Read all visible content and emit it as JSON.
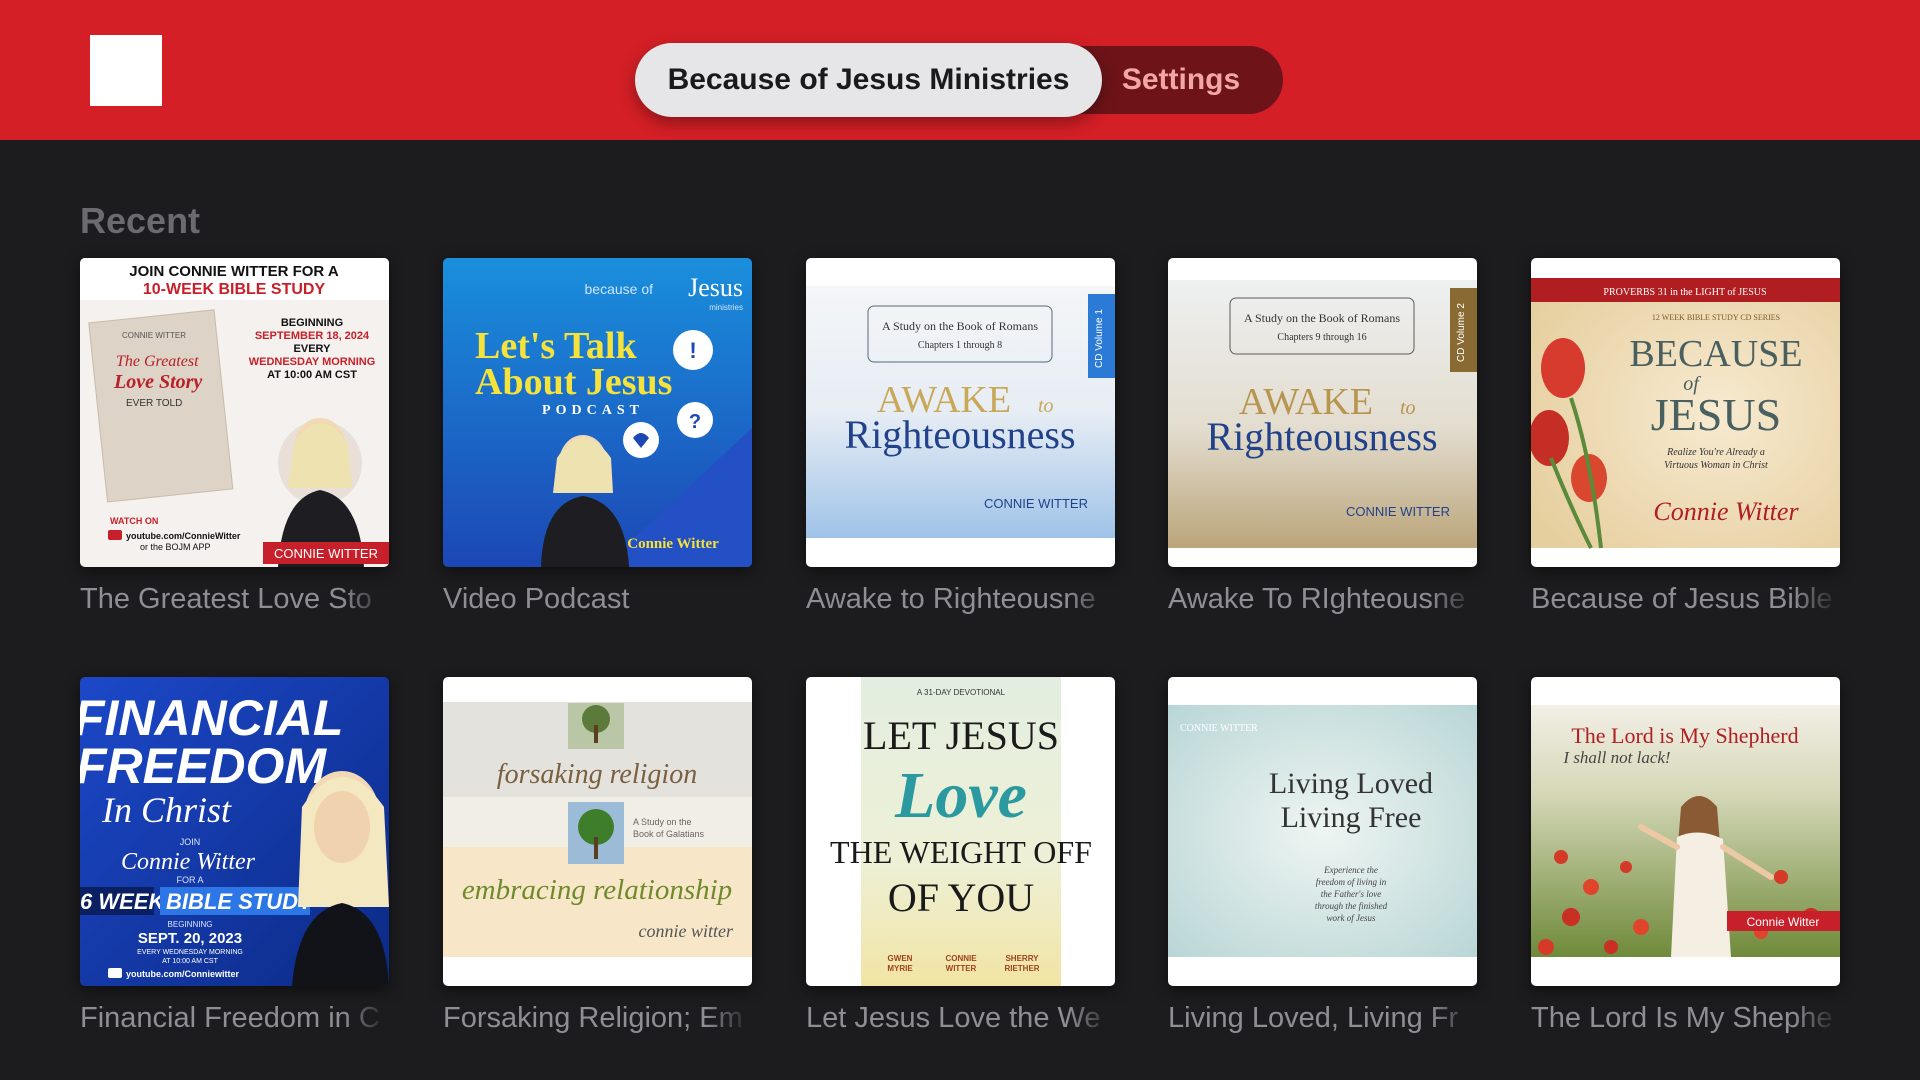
{
  "nav": {
    "logo": "white-square-logo",
    "tabs": [
      {
        "label": "Because of Jesus Ministries",
        "selected": true
      },
      {
        "label": "Settings",
        "selected": false
      }
    ]
  },
  "section": {
    "title": "Recent"
  },
  "items": [
    {
      "title": "The Greatest Love Sto",
      "art": {
        "l1": "JOIN CONNIE WITTER FOR A",
        "l2": "10-WEEK BIBLE STUDY",
        "author": "CONNIE WITTER",
        "book1": "The Greatest",
        "book2": "Love Story",
        "book3": "EVER TOLD",
        "d1": "BEGINNING",
        "d2": "SEPTEMBER 18, 2024",
        "d3": "EVERY",
        "d4": "WEDNESDAY MORNING",
        "d5": "AT 10:00 AM CST",
        "w1": "WATCH ON",
        "w2": "youtube.com/ConnieWitter",
        "w3": "or the BOJM APP",
        "tag": "CONNIE WITTER"
      }
    },
    {
      "title": "Video Podcast",
      "art": {
        "brand1": "because of",
        "brand2": "Jesus",
        "brand3": "ministries",
        "t1": "Let's Talk",
        "t2": "About Jesus",
        "t3": "PODCAST",
        "author": "Connie Witter"
      }
    },
    {
      "title": "Awake to Righteousne",
      "art": {
        "sub1": "A Study on the Book of Romans",
        "sub2": "Chapters 1 through 8",
        "t1": "AWAKE",
        "t1b": "to",
        "t2": "Righteousness",
        "author": "CONNIE WITTER",
        "vol": "CD Volume 1"
      }
    },
    {
      "title": "Awake To RIghteousne",
      "art": {
        "sub1": "A Study on the Book of Romans",
        "sub2": "Chapters 9 through 16",
        "t1": "AWAKE",
        "t1b": "to",
        "t2": "Righteousness",
        "author": "CONNIE WITTER",
        "vol": "CD Volume 2"
      }
    },
    {
      "title": "Because of Jesus Bible",
      "art": {
        "top": "PROVERBS 31 in the LIGHT of JESUS",
        "sub": "12 WEEK BIBLE STUDY CD SERIES",
        "t1": "BECAUSE",
        "t2": "of",
        "t3": "JESUS",
        "s1": "Realize You're Already a",
        "s2": "Virtuous Woman in Christ",
        "sig": "Connie Witter"
      }
    },
    {
      "title": "Financial Freedom in C",
      "art": {
        "t1": "FINANCIAL",
        "t2": "FREEDOM",
        "t3": "In Christ",
        "join": "JOIN",
        "name": "Connie Witter",
        "fora": "FOR A",
        "w": "6 WEEK",
        "b": "BIBLE STUDY",
        "beg": "BEGINNING",
        "date": "SEPT. 20, 2023",
        "ev1": "EVERY WEDNESDAY MORNING",
        "ev2": "AT 10:00 AM CST",
        "yt": "youtube.com/Conniewitter"
      }
    },
    {
      "title": "Forsaking Religion; Em",
      "art": {
        "t1": "forsaking religion",
        "s1": "A Study on the",
        "s2": "Book of Galatians",
        "t2": "embracing relationship",
        "author": "connie witter"
      }
    },
    {
      "title": "Let Jesus Love the We",
      "art": {
        "top": "A 31-DAY DEVOTIONAL",
        "t1": "LET JESUS",
        "t2": "Love",
        "t3": "THE WEIGHT OFF",
        "t4": "OF YOU",
        "a1a": "GWEN",
        "a1b": "MYRIE",
        "a2a": "CONNIE",
        "a2b": "WITTER",
        "a3a": "SHERRY",
        "a3b": "RIETHER"
      }
    },
    {
      "title": "Living Loved, Living Fr",
      "art": {
        "author": "CONNIE WITTER",
        "t1": "Living Loved",
        "t2": "Living Free",
        "q1": "Experience the",
        "q2": "freedom of living in",
        "q3": "the Father's love",
        "q4": "through the finished",
        "q5": "work of Jesus"
      }
    },
    {
      "title": "The Lord Is My Shephe",
      "art": {
        "t1": "The Lord is My Shepherd",
        "t2": "I shall not lack!",
        "tag": "Connie Witter"
      }
    }
  ],
  "colors": {
    "topbar": "#d41f26",
    "background": "#1c1c1e",
    "caption": "#8e8e93",
    "section_title": "#6b6b6f"
  }
}
